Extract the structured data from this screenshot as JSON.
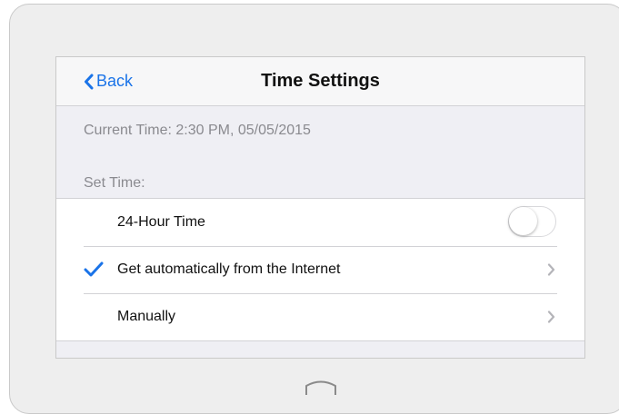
{
  "navbar": {
    "back_label": "Back",
    "title": "Time Settings"
  },
  "info": {
    "current_time": "Current Time: 2:30 PM, 05/05/2015",
    "section_header": "Set Time:"
  },
  "settings": {
    "hour24": {
      "label": "24-Hour Time",
      "enabled": false
    },
    "auto": {
      "label": "Get automatically from the Internet",
      "selected": true
    },
    "manual": {
      "label": "Manually",
      "selected": false
    }
  },
  "icons": {
    "back": "chevron-left-icon",
    "check": "checkmark-icon",
    "disclosure": "chevron-right-icon",
    "home": "home-button-icon"
  },
  "colors": {
    "accent": "#1a73e8",
    "secondary_text": "#8a8a8f",
    "background": "#efeff4"
  }
}
